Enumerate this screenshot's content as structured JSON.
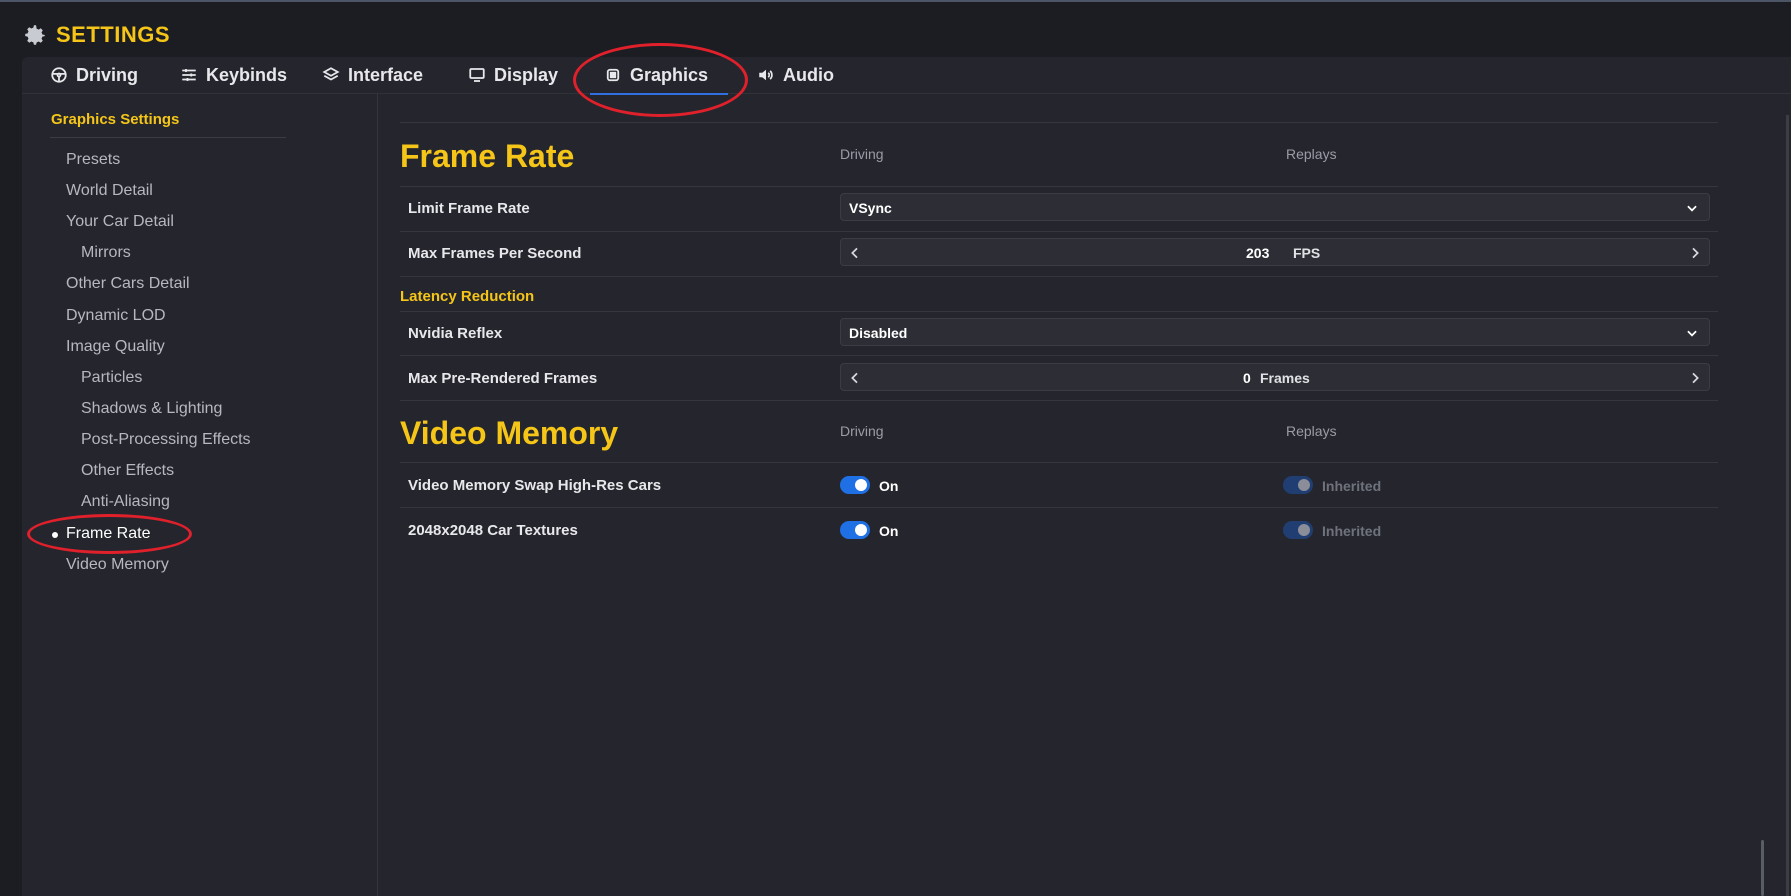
{
  "app": {
    "title": "SETTINGS"
  },
  "tabs": [
    {
      "label": "Driving",
      "icon": "steering-wheel-icon"
    },
    {
      "label": "Keybinds",
      "icon": "sliders-icon"
    },
    {
      "label": "Interface",
      "icon": "layers-icon"
    },
    {
      "label": "Display",
      "icon": "monitor-icon"
    },
    {
      "label": "Graphics",
      "icon": "chip-icon",
      "active": true
    },
    {
      "label": "Audio",
      "icon": "speaker-icon"
    }
  ],
  "sidebar": {
    "header": "Graphics Settings",
    "items": [
      {
        "label": "Presets"
      },
      {
        "label": "World Detail"
      },
      {
        "label": "Your Car Detail"
      },
      {
        "label": "Mirrors",
        "indent": 1
      },
      {
        "label": "Other Cars Detail"
      },
      {
        "label": "Dynamic LOD"
      },
      {
        "label": "Image Quality"
      },
      {
        "label": "Particles",
        "indent": 1
      },
      {
        "label": "Shadows & Lighting",
        "indent": 1
      },
      {
        "label": "Post-Processing Effects",
        "indent": 1
      },
      {
        "label": "Other Effects",
        "indent": 1
      },
      {
        "label": "Anti-Aliasing",
        "indent": 1
      },
      {
        "label": "Frame Rate",
        "active": true
      },
      {
        "label": "Video Memory"
      }
    ]
  },
  "frame_rate": {
    "title": "Frame Rate",
    "col_driving": "Driving",
    "col_replays": "Replays",
    "limit_frame_rate": {
      "label": "Limit Frame Rate",
      "value": "VSync"
    },
    "max_fps": {
      "label": "Max Frames Per Second",
      "value": "203",
      "unit": "FPS"
    },
    "latency_header": "Latency Reduction",
    "nvidia_reflex": {
      "label": "Nvidia Reflex",
      "value": "Disabled"
    },
    "max_prerendered": {
      "label": "Max Pre-Rendered Frames",
      "value": "0",
      "unit": "Frames"
    }
  },
  "video_memory": {
    "title": "Video Memory",
    "col_driving": "Driving",
    "col_replays": "Replays",
    "swap_cars": {
      "label": "Video Memory Swap High-Res Cars",
      "driving": "On",
      "replays": "Inherited"
    },
    "car_textures": {
      "label": "2048x2048 Car Textures",
      "driving": "On",
      "replays": "Inherited"
    }
  },
  "colors": {
    "accent": "#f5c518",
    "toggle_on": "#1f6fe5",
    "annotation": "#e0202b"
  }
}
